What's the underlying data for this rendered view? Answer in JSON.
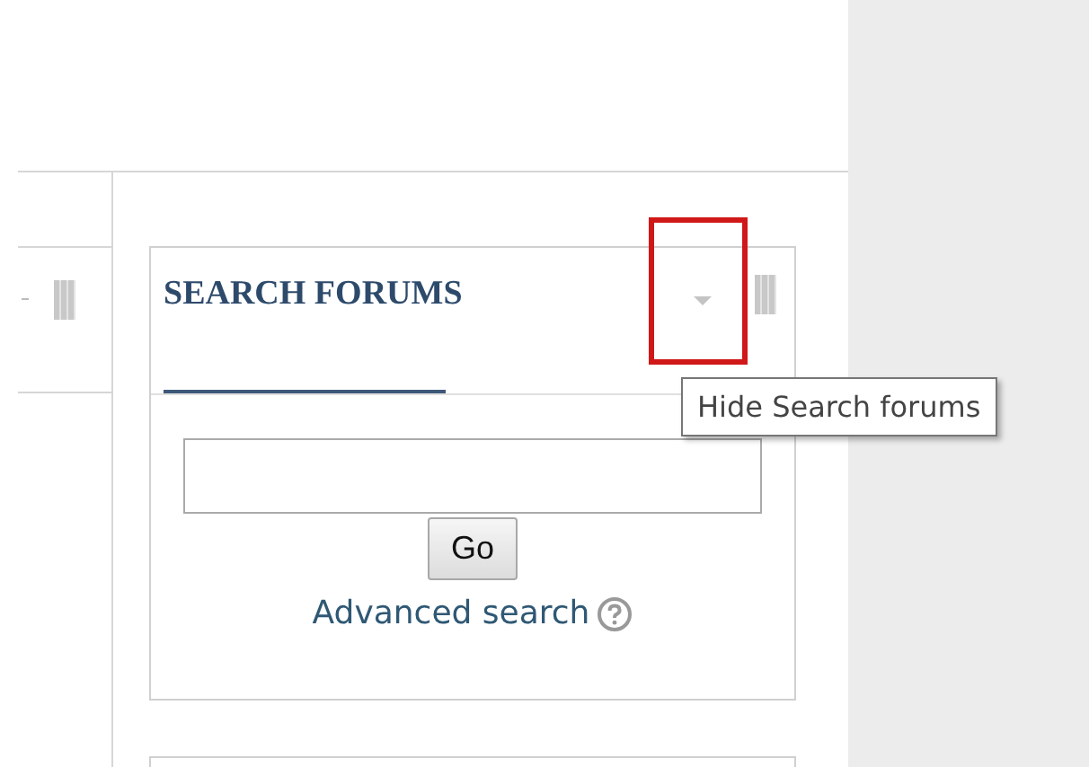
{
  "search_block": {
    "title": "SEARCH FORUMS",
    "go_button": "Go",
    "advanced_link": "Advanced search",
    "tooltip": "Hide Search forums"
  }
}
